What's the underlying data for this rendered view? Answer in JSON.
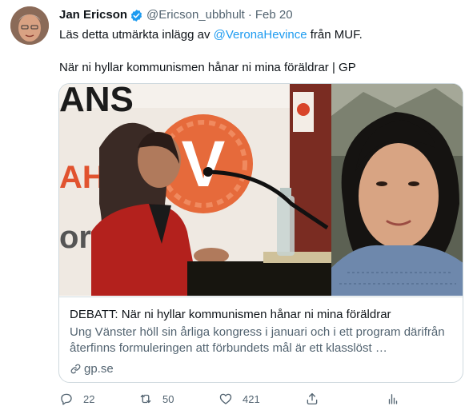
{
  "tweet": {
    "author_name": "Jan Ericson",
    "author_handle": "@Ericson_ubbhult",
    "separator": "·",
    "date": "Feb 20",
    "text_prefix": "Läs detta utmärkta inlägg av ",
    "mention": "@VeronaHevince",
    "text_suffix": " från MUF.",
    "linked_title": "När ni hyllar kommunismen hånar ni mina föräldrar | GP"
  },
  "card": {
    "title": "DEBATT: När ni hyllar kommunismen hånar ni mina föräldrar",
    "description": "Ung Vänster höll sin årliga kongress i januari och i ett program därifrån återfinns formuleringen att förbundets mål är ett klasslöst …",
    "domain": "gp.se",
    "left_image_letter": "V",
    "left_image_text": "ANS"
  },
  "actions": {
    "reply_count": "22",
    "retweet_count": "50",
    "like_count": "421"
  },
  "icons": {
    "verified": "verified-badge-icon",
    "link": "link-icon",
    "reply": "reply-icon",
    "retweet": "retweet-icon",
    "like": "heart-icon",
    "share": "share-icon",
    "analytics": "analytics-icon"
  },
  "colors": {
    "accent": "#1d9bf0",
    "text_primary": "#0f1419",
    "text_secondary": "#536471",
    "border": "#cfd9de"
  }
}
